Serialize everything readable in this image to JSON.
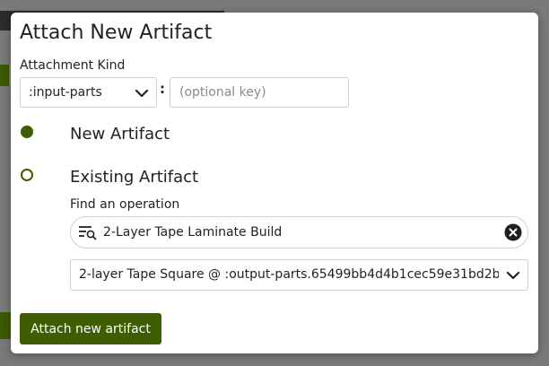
{
  "modal": {
    "title": "Attach New Artifact",
    "attachment_kind": {
      "label": "Attachment Kind",
      "selected_value": ":input-parts",
      "separator": ":",
      "key_placeholder": "(optional key)",
      "key_value": ""
    },
    "options": {
      "new_label": "New Artifact",
      "existing_label": "Existing Artifact",
      "selected": "new"
    },
    "find_operation": {
      "label": "Find an operation",
      "search_value": "2-Layer Tape Laminate Build",
      "selected_operation": "2-layer Tape Square @ :output-parts.65499bb4d4b1cec59e31bd2b"
    },
    "submit_label": "Attach new artifact"
  },
  "colors": {
    "accent": "#3f5d02",
    "modal_bg": "#ffffff",
    "backdrop": "#7a7a7a"
  },
  "icons": {
    "kind_dropdown": "chevron-down-icon",
    "search_filter": "filter-search-icon",
    "clear_search": "close-circle-icon",
    "operation_dropdown": "chevron-down-icon"
  }
}
